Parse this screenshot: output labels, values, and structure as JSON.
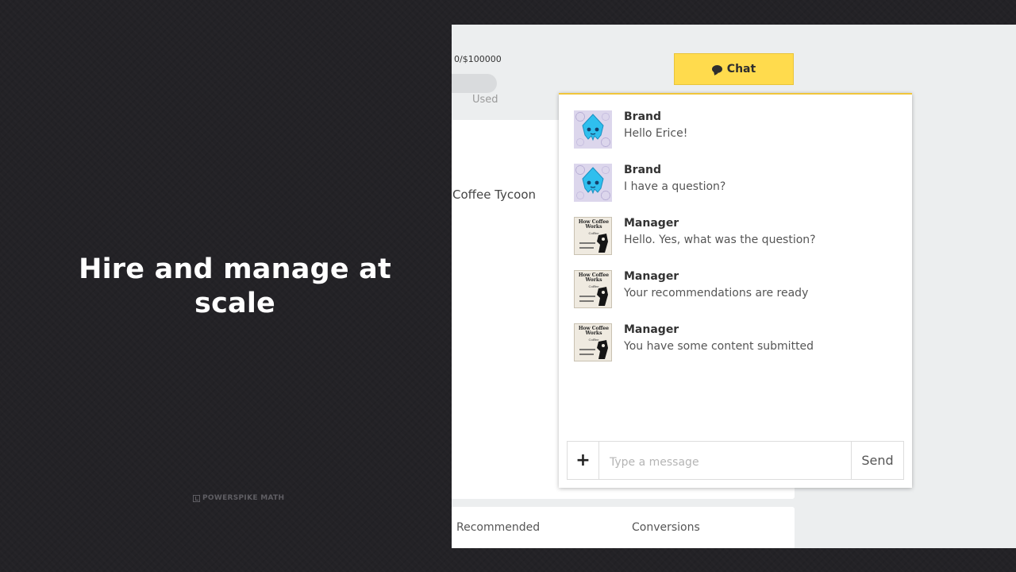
{
  "slide": {
    "headline": "Hire and manage at scale",
    "watermark": "POWERSPIKE MATH"
  },
  "app": {
    "budget_text": "0/$100000",
    "used_label": "Used",
    "project_name": "Coffee Tycoon",
    "chat_button_label": "Chat",
    "bottom_columns": [
      "Recommended",
      "Conversions"
    ],
    "colors": {
      "chat_button": "#ffdb4d",
      "panel_accent": "#f0c53a"
    }
  },
  "chat": {
    "messages": [
      {
        "sender": "Brand",
        "text": "Hello Erice!",
        "avatar": "brand-avatar"
      },
      {
        "sender": "Brand",
        "text": "I have a question?",
        "avatar": "brand-avatar"
      },
      {
        "sender": "Manager",
        "text": "Hello. Yes, what was the question?",
        "avatar": "manager-avatar"
      },
      {
        "sender": "Manager",
        "text": "Your recommendations are ready",
        "avatar": "manager-avatar"
      },
      {
        "sender": "Manager",
        "text": "You have some content submitted",
        "avatar": "manager-avatar"
      }
    ],
    "manager_avatar_title": "How Coffee Works",
    "manager_avatar_sub": "Coffee",
    "composer": {
      "add_label": "+",
      "placeholder": "Type a message",
      "value": "",
      "send_label": "Send"
    }
  }
}
